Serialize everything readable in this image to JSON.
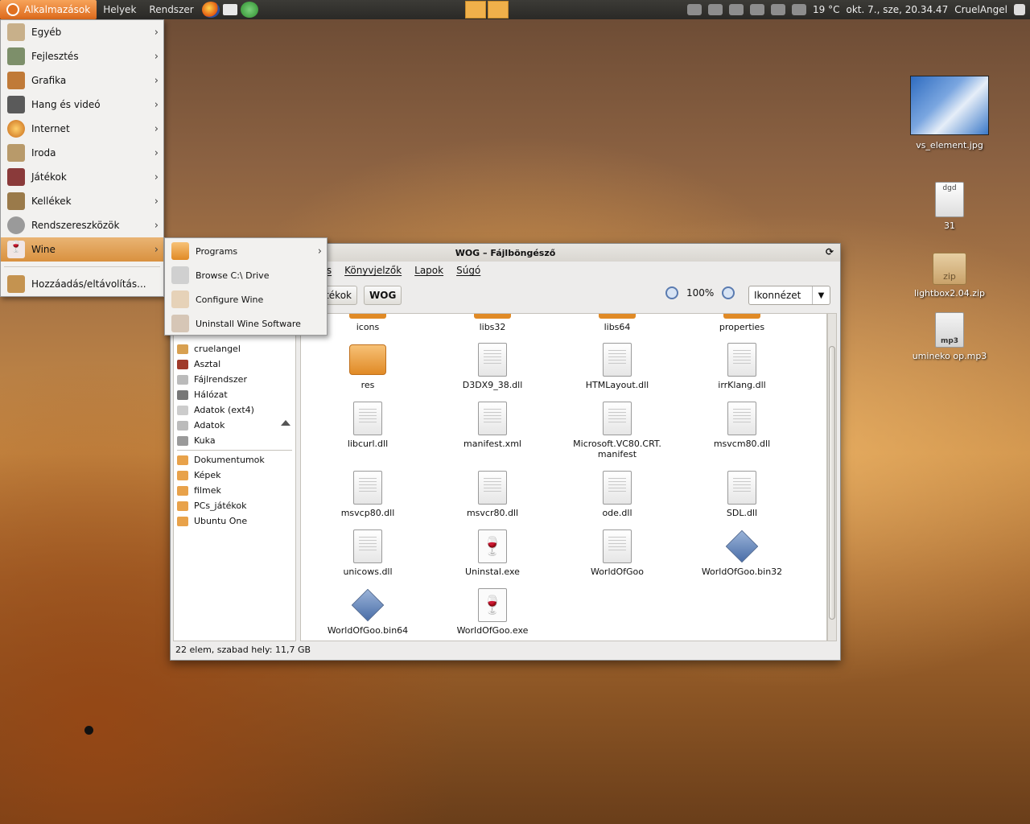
{
  "panel": {
    "menus": [
      "Alkalmazások",
      "Helyek",
      "Rendszer"
    ],
    "weather": "19 °C",
    "clock": "okt. 7., sze, 20.34.47",
    "user": "CruelAngel"
  },
  "app_menu": {
    "items": [
      "Egyéb",
      "Fejlesztés",
      "Grafika",
      "Hang és videó",
      "Internet",
      "Iroda",
      "Játékok",
      "Kellékek",
      "Rendszereszközök",
      "Wine"
    ],
    "footer": "Hozzáadás/eltávolítás..."
  },
  "wine_menu": {
    "items": [
      "Programs",
      "Browse C:\\ Drive",
      "Configure Wine",
      "Uninstall Wine Software"
    ]
  },
  "window": {
    "title": "WOG – Fájlböngésző",
    "menubar": [
      "Írás",
      "Könyvjelzők",
      "Lapok",
      "Súgó"
    ],
    "crumbs": [
      "PCs_játékok",
      "WOG"
    ],
    "zoom": "100%",
    "view": "Ikonnézet",
    "sidebar": {
      "places": [
        "cruelangel",
        "Asztal",
        "Fájlrendszer",
        "Hálózat",
        "Adatok (ext4)",
        "Adatok",
        "Kuka"
      ],
      "bookmarks": [
        "Dokumentumok",
        "Képek",
        "filmek",
        "PCs_játékok",
        "Ubuntu One"
      ]
    },
    "files": [
      "icons",
      "libs32",
      "libs64",
      "properties",
      "res",
      "D3DX9_38.dll",
      "HTMLayout.dll",
      "irrKlang.dll",
      "libcurl.dll",
      "manifest.xml",
      "Microsoft.VC80.CRT.\nmanifest",
      "msvcm80.dll",
      "msvcp80.dll",
      "msvcr80.dll",
      "ode.dll",
      "SDL.dll",
      "unicows.dll",
      "Uninstal.exe",
      "WorldOfGoo",
      "WorldOfGoo.bin32",
      "WorldOfGoo.bin64",
      "WorldOfGoo.exe"
    ],
    "status": "22 elem, szabad hely: 11,7 GB"
  },
  "desktop": {
    "icons": [
      "vs_element.jpg",
      "31",
      "lightbox2.04.zip",
      "umineko op.mp3"
    ],
    "file_preview_text": "dgd",
    "zip_label": "zip",
    "mp3_label": "mp3"
  }
}
